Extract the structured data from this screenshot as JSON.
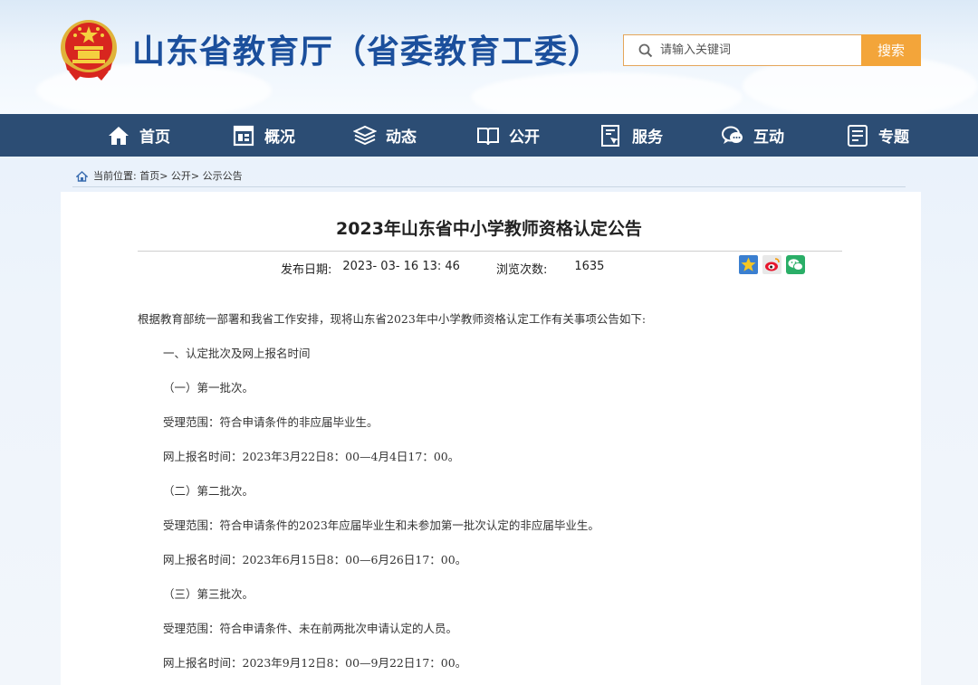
{
  "header": {
    "site_title": "山东省教育厅（省委教育工委）",
    "search_placeholder": "请输入关键词",
    "search_button": "搜索"
  },
  "nav": {
    "items": [
      {
        "label": "首页",
        "icon": "home-icon"
      },
      {
        "label": "概况",
        "icon": "overview-icon"
      },
      {
        "label": "动态",
        "icon": "news-stack-icon"
      },
      {
        "label": "公开",
        "icon": "open-book-icon"
      },
      {
        "label": "服务",
        "icon": "service-doc-icon"
      },
      {
        "label": "互动",
        "icon": "chat-bubbles-icon"
      },
      {
        "label": "专题",
        "icon": "topic-list-icon"
      }
    ]
  },
  "breadcrumb": {
    "text": "当前位置: 首页> 公开> 公示公告"
  },
  "article": {
    "title": "2023年山东省中小学教师资格认定公告",
    "publish_label": "发布日期:",
    "publish_date": "2023- 03- 16 13: 46",
    "views_label": "浏览次数:",
    "views": "1635",
    "share_icons": [
      "favorite-star-icon",
      "weibo-icon",
      "wechat-icon"
    ],
    "paragraphs": [
      "根据教育部统一部署和我省工作安排，现将山东省2023年中小学教师资格认定工作有关事项公告如下:",
      "一、认定批次及网上报名时间",
      "（一）第一批次。",
      "受理范围：符合申请条件的非应届毕业生。",
      "网上报名时间：2023年3月22日8：00—4月4日17：00。",
      "（二）第二批次。",
      "受理范围：符合申请条件的2023年应届毕业生和未参加第一批次认定的非应届毕业生。",
      "网上报名时间：2023年6月15日8：00—6月26日17：00。",
      "（三）第三批次。",
      "受理范围：符合申请条件、未在前两批次申请认定的人员。",
      "网上报名时间：2023年9月12日8：00—9月22日17：00。"
    ]
  },
  "colors": {
    "nav_bg": "#2c4d74",
    "title_blue": "#1b4f9c",
    "search_orange": "#f3a53a"
  }
}
